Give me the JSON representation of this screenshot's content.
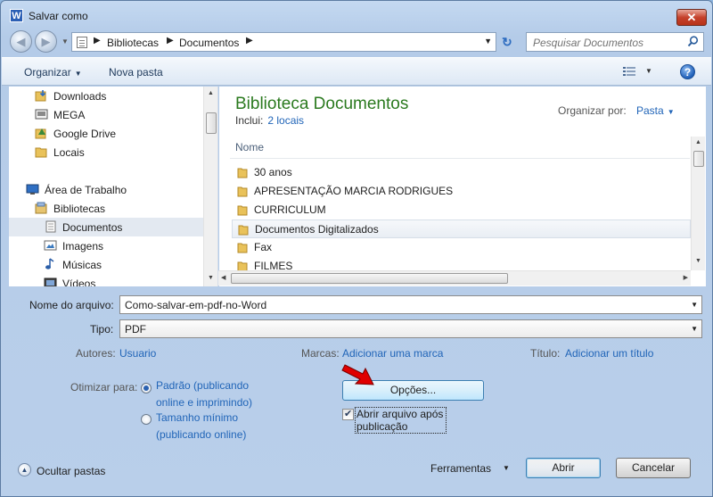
{
  "window": {
    "title": "Salvar como",
    "app_icon_letter": "W",
    "close_glyph": "✕"
  },
  "nav": {
    "back_glyph": "◀",
    "forward_glyph": "▶",
    "breadcrumb": [
      "Bibliotecas",
      "Documentos"
    ],
    "breadcrumb_sep": "▶",
    "refresh_glyph": "↻",
    "search_placeholder": "Pesquisar Documentos"
  },
  "toolbar": {
    "organize_label": "Organizar",
    "new_folder_label": "Nova pasta",
    "caret": "▼",
    "help_glyph": "?"
  },
  "sidebar": {
    "items": [
      {
        "label": "Downloads",
        "icon": "downloads-folder-icon"
      },
      {
        "label": "MEGA",
        "icon": "mega-drive-icon"
      },
      {
        "label": "Google Drive",
        "icon": "google-drive-folder-icon"
      },
      {
        "label": "Locais",
        "icon": "folder-icon"
      },
      {
        "label": "Área de Trabalho",
        "icon": "desktop-icon"
      },
      {
        "label": "Bibliotecas",
        "icon": "libraries-icon"
      },
      {
        "label": "Documentos",
        "icon": "documents-icon"
      },
      {
        "label": "Imagens",
        "icon": "images-icon"
      },
      {
        "label": "Músicas",
        "icon": "music-icon"
      },
      {
        "label": "Vídeos",
        "icon": "videos-icon"
      }
    ],
    "selected": "Documentos"
  },
  "content": {
    "title": "Biblioteca Documentos",
    "includes_label": "Inclui:",
    "includes_link": "2 locais",
    "organize_by_label": "Organizar por:",
    "organize_by_value": "Pasta",
    "column_name": "Nome",
    "files": [
      "30 anos",
      "APRESENTAÇÃO MARCIA RODRIGUES",
      "CURRICULUM",
      "Documentos Digitalizados",
      "Fax",
      "FILMES"
    ],
    "hovered": "Documentos Digitalizados"
  },
  "form": {
    "filename_label": "Nome do arquivo:",
    "filename_value": "Como-salvar-em-pdf-no-Word",
    "type_label": "Tipo:",
    "type_value": "PDF",
    "authors_label": "Autores:",
    "authors_value": "Usuario",
    "tags_label": "Marcas:",
    "tags_value": "Adicionar uma marca",
    "title_label": "Título:",
    "title_value": "Adicionar um título",
    "optimize_label": "Otimizar para:",
    "optimize_options": [
      {
        "line1": "Padrão (publicando",
        "line2": "online e imprimindo)",
        "checked": true
      },
      {
        "line1": "Tamanho mínimo",
        "line2": "(publicando online)",
        "checked": false
      }
    ],
    "options_button": "Opções...",
    "open_after_line1": "Abrir arquivo após",
    "open_after_line2": "publicação",
    "open_after_checked": true,
    "check_glyph": "✔"
  },
  "footer": {
    "hide_folders_label": "Ocultar pastas",
    "hide_folders_glyph": "▲",
    "tools_label": "Ferramentas",
    "save_button": "Abrir",
    "cancel_button": "Cancelar"
  },
  "colors": {
    "title_green": "#2b7a1f",
    "link_blue": "#2165b8",
    "annotation_arrow": "#e00000"
  }
}
